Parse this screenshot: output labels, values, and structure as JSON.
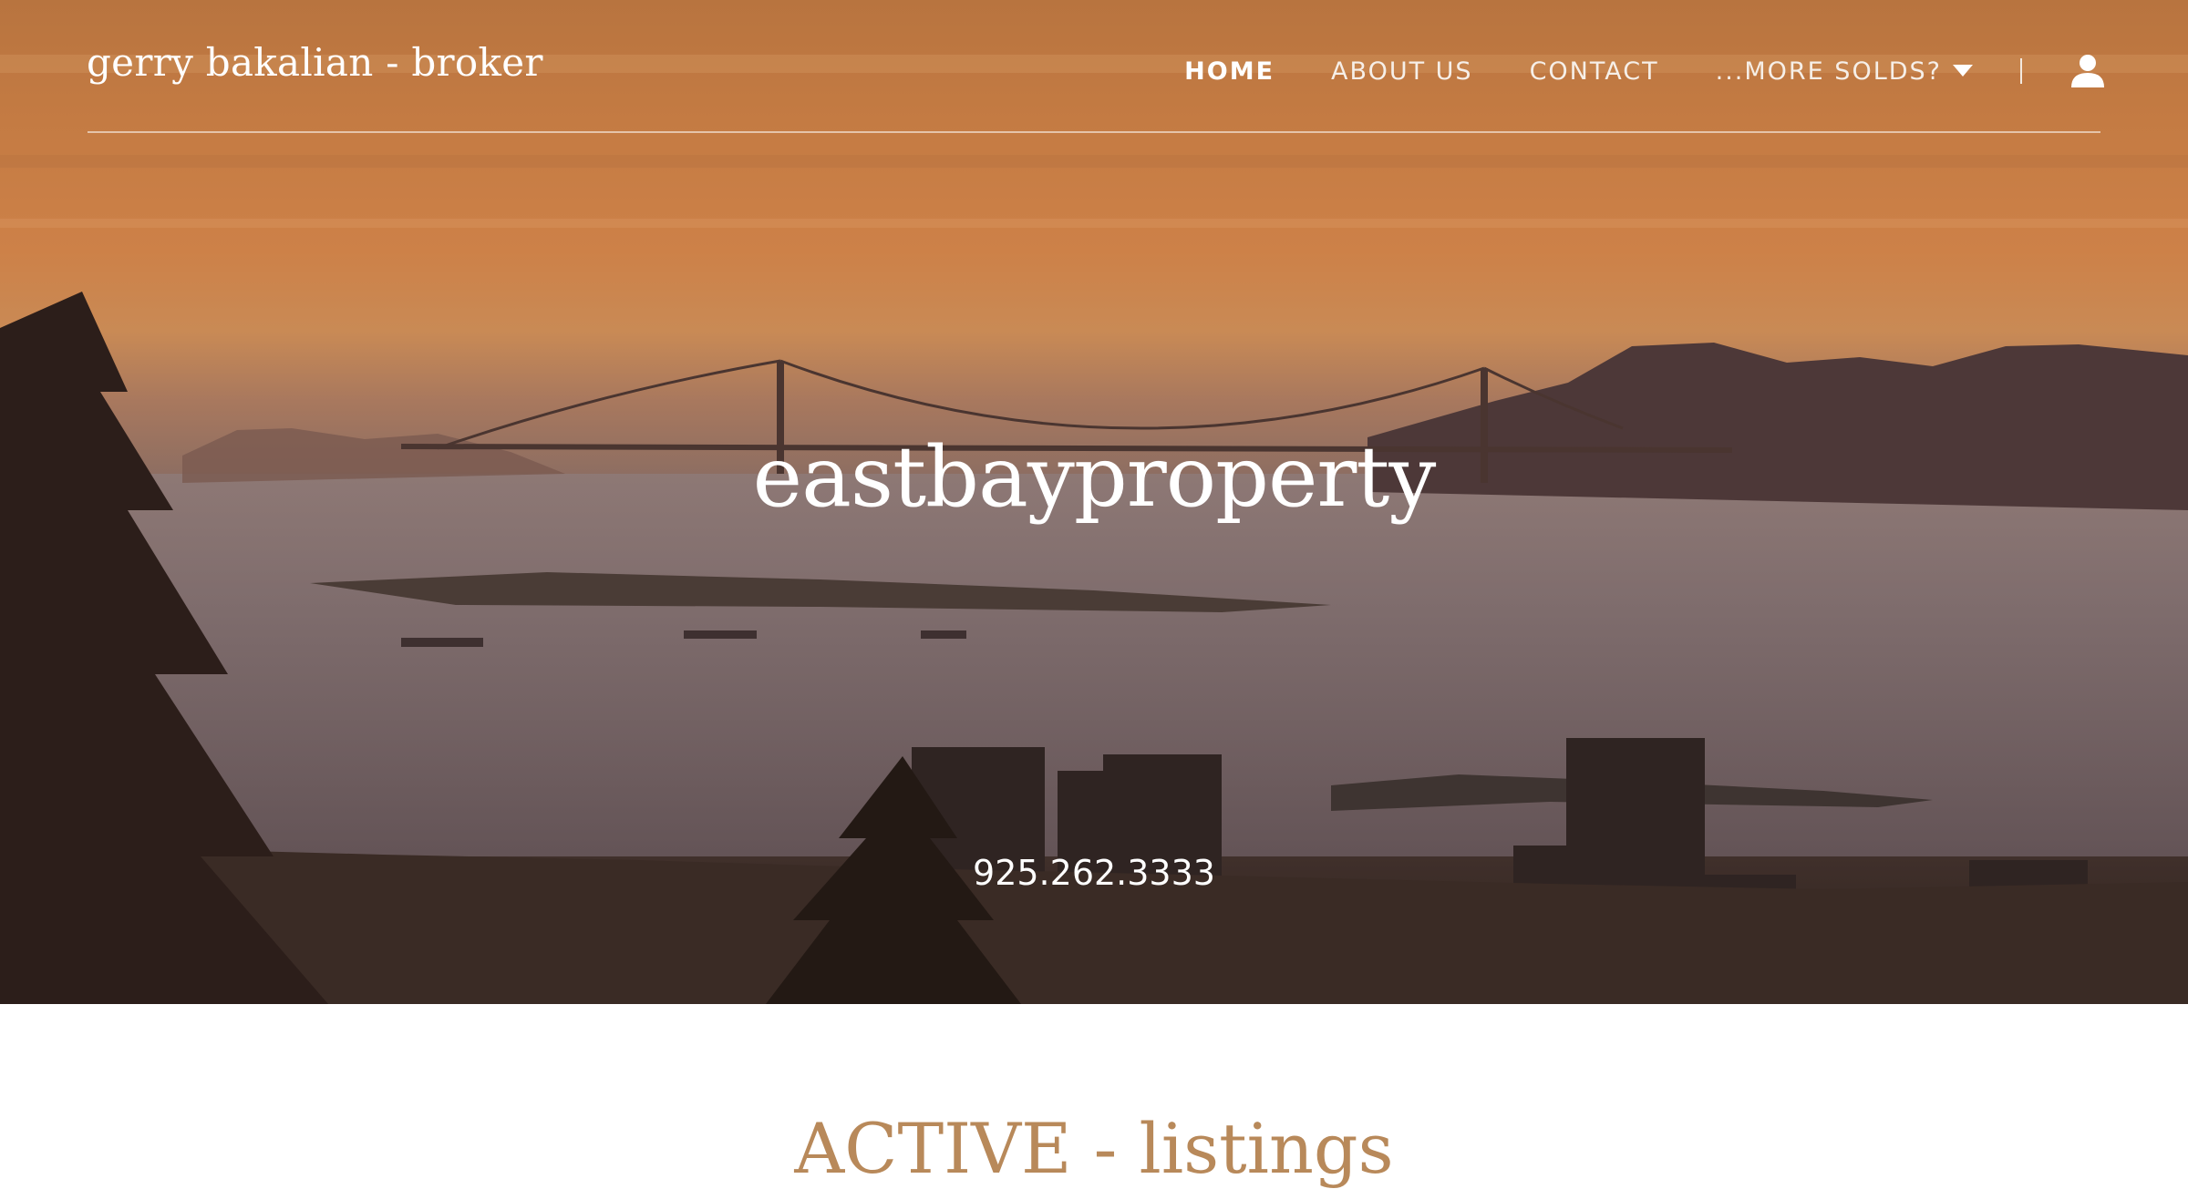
{
  "header": {
    "brand": "gerry bakalian - broker",
    "nav": [
      {
        "label": "HOME",
        "active": true
      },
      {
        "label": "ABOUT US",
        "active": false
      },
      {
        "label": "CONTACT",
        "active": false
      },
      {
        "label": "...MORE SOLDS?",
        "active": false,
        "has_dropdown": true
      }
    ],
    "account_icon": "user-icon"
  },
  "hero": {
    "title": "eastbayproperty",
    "phone": "925.262.3333",
    "background": "sunset over bay with suspension bridge and city skyline"
  },
  "section": {
    "title": "ACTIVE - listings"
  },
  "colors": {
    "hero_text": "#ffffff",
    "section_title": "#b8895a",
    "sky_top": "#b8743f",
    "sky_mid": "#cd8148"
  }
}
